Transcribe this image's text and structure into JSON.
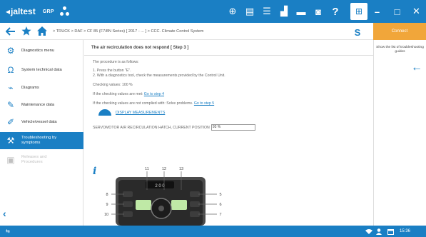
{
  "app": {
    "logo_text": "jaltest",
    "group_label": "GRP"
  },
  "toolbar_icons": [
    "globe-icon",
    "document-icon",
    "list-icon",
    "dashboard-icon",
    "printer-icon",
    "camera-icon",
    "help-icon"
  ],
  "toolbar_glyphs": [
    "⊕",
    "▤",
    "☰",
    "▟",
    "▬",
    "◙",
    "?"
  ],
  "window_controls": {
    "grid": "⊞",
    "minimize": "–",
    "maximize": "□",
    "close": "✕"
  },
  "breadcrumb": [
    "TRUCK",
    "DAF",
    "CF 85 (F7/8N Series) [ 2017 - ... ]",
    "CCC. Climate Control System"
  ],
  "breadcrumb_separator": ">",
  "connect_label": "Connect",
  "filter_glyph": "S",
  "sidebar": {
    "items": [
      {
        "label": "Diagnostics menu",
        "icon": "diagnostics-icon",
        "glyph": "⚙"
      },
      {
        "label": "System technical data",
        "icon": "technical-data-icon",
        "glyph": "Ω"
      },
      {
        "label": "Diagrams",
        "icon": "diagrams-icon",
        "glyph": "⌁"
      },
      {
        "label": "Maintenance data",
        "icon": "maintenance-icon",
        "glyph": "✎"
      },
      {
        "label": "Vehicle/vessel data",
        "icon": "vehicle-data-icon",
        "glyph": "✐"
      },
      {
        "label": "Troubleshooting by symptoms",
        "icon": "troubleshooting-icon",
        "glyph": "⚒"
      },
      {
        "label": "Releases and Procedures",
        "icon": "procedures-icon",
        "glyph": "▣"
      }
    ],
    "back_glyph": "‹"
  },
  "main": {
    "title": "The air recirculation does not respond [ Step 3 ]",
    "intro": "The procedure is as follows:",
    "step1": "1. Press the button \"E\".",
    "step2": "2. With a diagnostics tool, check the measurements provided by the Control Unit.",
    "checking_values": "Checking values: 100 %",
    "met_prefix": "If the checking values are met: ",
    "met_link": "Go to step 4",
    "not_met_prefix": "If the checking values are not complied with: Solve problems. ",
    "not_met_link": "Go to step 5",
    "display_measurements": "DISPLAY MEASUREMENTS",
    "servo_label": "SERVOMOTOR AIR RECIRCULATION HATCH, CURRENT POSITION",
    "servo_value": "93 %",
    "info_glyph": "i"
  },
  "diagram": {
    "callouts_top": [
      "11",
      "12",
      "13"
    ],
    "callouts_left": [
      "8",
      "9",
      "10"
    ],
    "callouts_right": [
      "5",
      "6",
      "7"
    ],
    "panel_display": "2 0 0"
  },
  "right_panel": {
    "show_list": "Show the list of troubleshooting guides",
    "arrow": "←"
  },
  "status_bar": {
    "left_glyph": "⇆",
    "time": "15:36"
  },
  "colors": {
    "primary": "#1a7fc4",
    "accent": "#f1a63a"
  }
}
